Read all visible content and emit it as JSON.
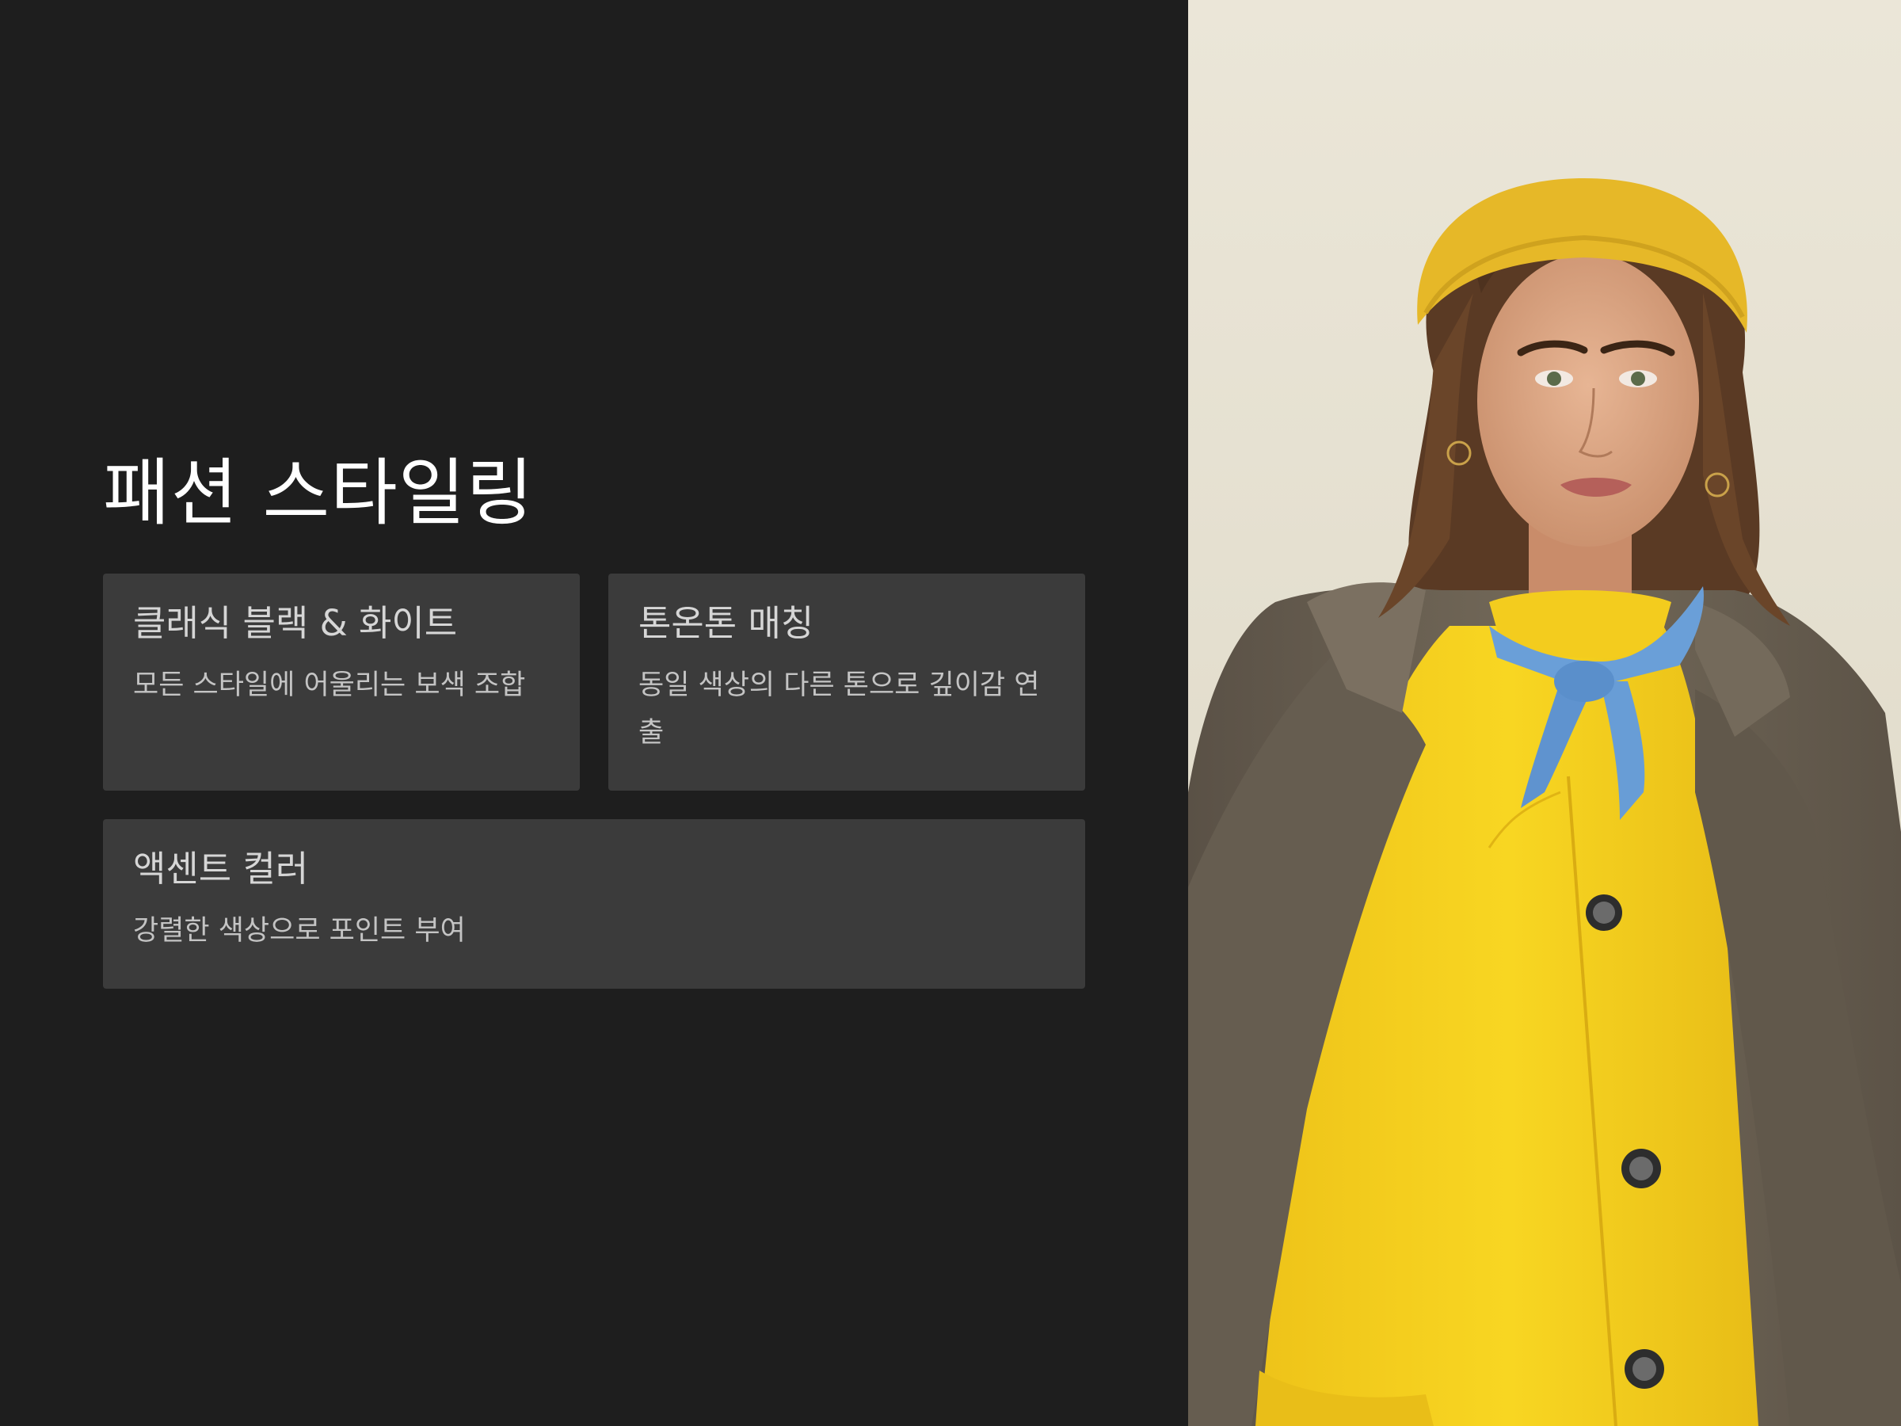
{
  "slide": {
    "title": "패션 스타일링",
    "cards": [
      {
        "title": "클래식 블랙 & 화이트",
        "description": "모든 스타일에 어울리는 보색 조합"
      },
      {
        "title": "톤온톤 매칭",
        "description": "동일 색상의 다른 톤으로 깊이감 연출"
      },
      {
        "title": "액센트 컬러",
        "description": "강렬한 색상으로 포인트 부여"
      }
    ]
  },
  "photo": {
    "subject": "model-yellow-outfit",
    "colors": {
      "background": "#e6e1d2",
      "beanie": "#e6b828",
      "cardigan": "#f5d11c",
      "scarf": "#6a9fd8",
      "coat": "#6b6154",
      "hair": "#5a3a24",
      "skin": "#d9a583"
    }
  },
  "theme": {
    "background": "#1e1e1e",
    "card": "#3b3b3b",
    "title_color": "#ffffff",
    "text_color": "#c4c4c4"
  }
}
